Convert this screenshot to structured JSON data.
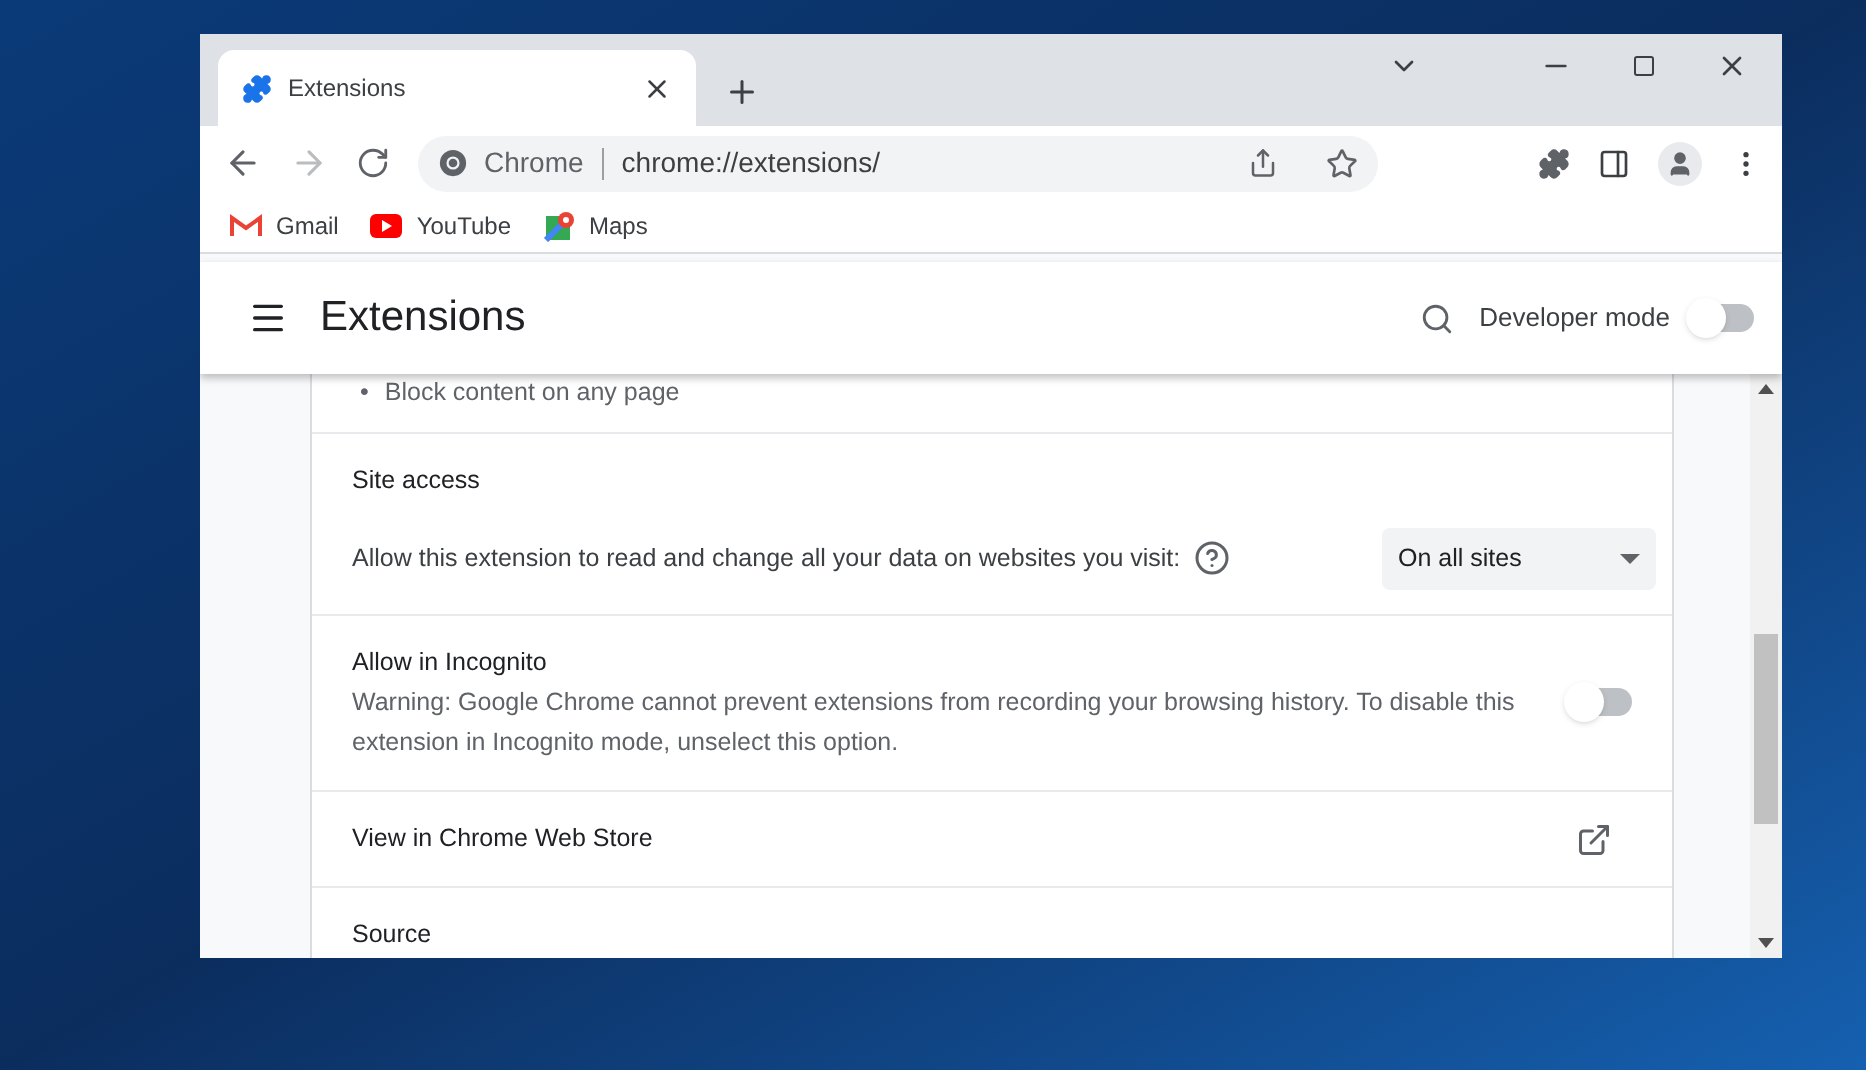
{
  "tab": {
    "title": "Extensions",
    "selected": true
  },
  "address_bar": {
    "site_label": "Chrome",
    "url": "chrome://extensions/"
  },
  "bookmarks": [
    {
      "kind": "gmail",
      "label": "Gmail"
    },
    {
      "kind": "youtube",
      "label": "YouTube"
    },
    {
      "kind": "maps",
      "label": "Maps"
    }
  ],
  "header": {
    "title": "Extensions",
    "developer_mode": {
      "label": "Developer mode",
      "on": false
    }
  },
  "permissions": [
    {
      "bullet": "•",
      "text": "Block content on any page"
    }
  ],
  "site_access": {
    "title": "Site access",
    "label": "Allow this extension to read and change all your data on websites you visit:",
    "value": "On all sites"
  },
  "incognito": {
    "title": "Allow in Incognito",
    "warning": "Warning: Google Chrome cannot prevent extensions from recording your browsing history. To disable this extension in Incognito mode, unselect this option.",
    "on": false
  },
  "web_store_link": "View in Chrome Web Store",
  "source": {
    "title": "Source"
  }
}
